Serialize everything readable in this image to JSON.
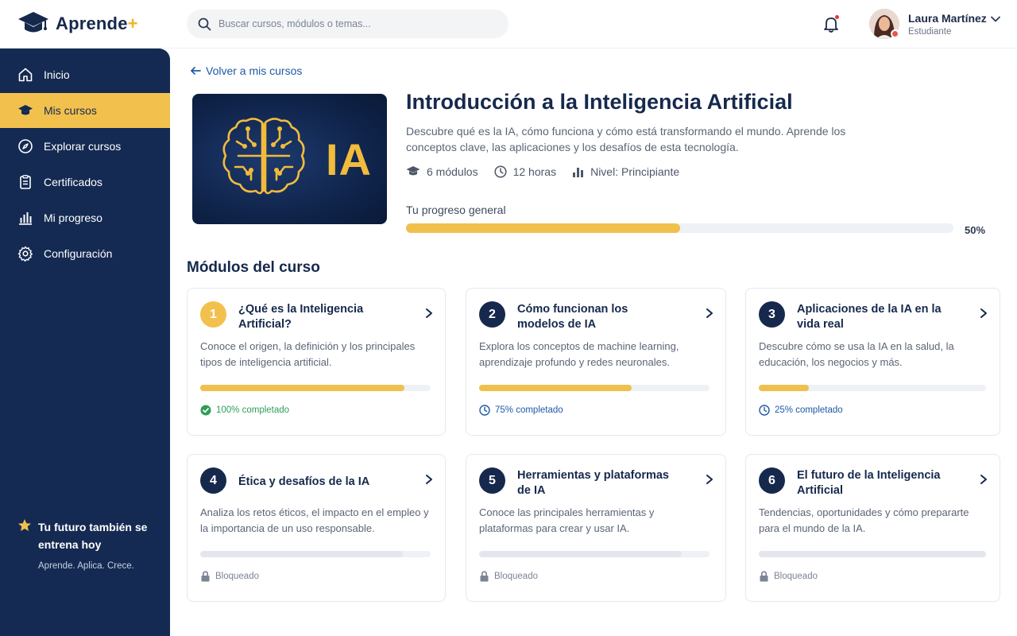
{
  "app": {
    "name": "Aprende",
    "name_plus": "+"
  },
  "search": {
    "placeholder": "Buscar cursos, módulos o temas..."
  },
  "user": {
    "name": "Laura Martínez",
    "role": "Estudiante"
  },
  "sidebar": {
    "items": [
      {
        "label": "Inicio",
        "icon": "home-icon"
      },
      {
        "label": "Mis cursos",
        "icon": "graduation-cap-icon",
        "active": true
      },
      {
        "label": "Explorar cursos",
        "icon": "compass-icon"
      },
      {
        "label": "Certificados",
        "icon": "clipboard-icon"
      },
      {
        "label": "Mi progreso",
        "icon": "bar-chart-icon"
      },
      {
        "label": "Configuración",
        "icon": "gear-icon"
      }
    ],
    "promo": {
      "title": "Tu futuro también se entrena hoy",
      "subtitle": "Aprende. Aplica. Crece."
    }
  },
  "course": {
    "back_label": "Volver a mis cursos",
    "image_label": "IA",
    "title": "Introducción a la Inteligencia Artificial",
    "description": "Descubre qué es la IA, cómo funciona y cómo está transformando el mundo. Aprende los conceptos clave, las aplicaciones y los desafíos de esta tecnología.",
    "modules_count": "6 módulos",
    "duration": "12 horas",
    "level": "Nivel: Principiante",
    "progress_label": "Tu progreso general",
    "progress_value": 50,
    "progress_text": "50%"
  },
  "modules_title": "Módulos del curso",
  "modules": [
    {
      "number": "1",
      "title": "¿Qué es la Inteligencia Artificial?",
      "description": "Conoce el origen, la definición y los principales tipos de inteligencia artificial.",
      "progress": 100,
      "status": "100% completado",
      "state": "done"
    },
    {
      "number": "2",
      "title": "Cómo funcionan los modelos de IA",
      "description": "Explora los conceptos de machine learning, aprendizaje profundo y redes neuronales.",
      "progress": 75,
      "status": "75% completado",
      "state": "progress"
    },
    {
      "number": "3",
      "title": "Aplicaciones de la IA en la vida real",
      "description": "Descubre cómo se usa la IA en la salud, la educación, los negocios y más.",
      "progress": 25,
      "status": "25% completado",
      "state": "progress"
    },
    {
      "number": "4",
      "title": "Ética y desafíos de la IA",
      "description": "Analiza los retos éticos, el impacto en el empleo y la importancia de un uso responsable.",
      "progress": 0,
      "status": "Bloqueado",
      "state": "locked"
    },
    {
      "number": "5",
      "title": "Herramientas y plataformas de IA",
      "description": "Conoce las principales herramientas y plataformas para crear y usar IA.",
      "progress": 0,
      "status": "Bloqueado",
      "state": "locked"
    },
    {
      "number": "6",
      "title": "El futuro de la Inteligencia Artificial",
      "description": "Tendencias, oportunidades y cómo prepararte para el mundo de la IA.",
      "progress": 0,
      "status": "Bloqueado",
      "state": "locked"
    }
  ],
  "colors": {
    "navy": "#142a52",
    "accent": "#f2c04c",
    "link": "#1d5aa8",
    "success": "#2e9e57"
  }
}
